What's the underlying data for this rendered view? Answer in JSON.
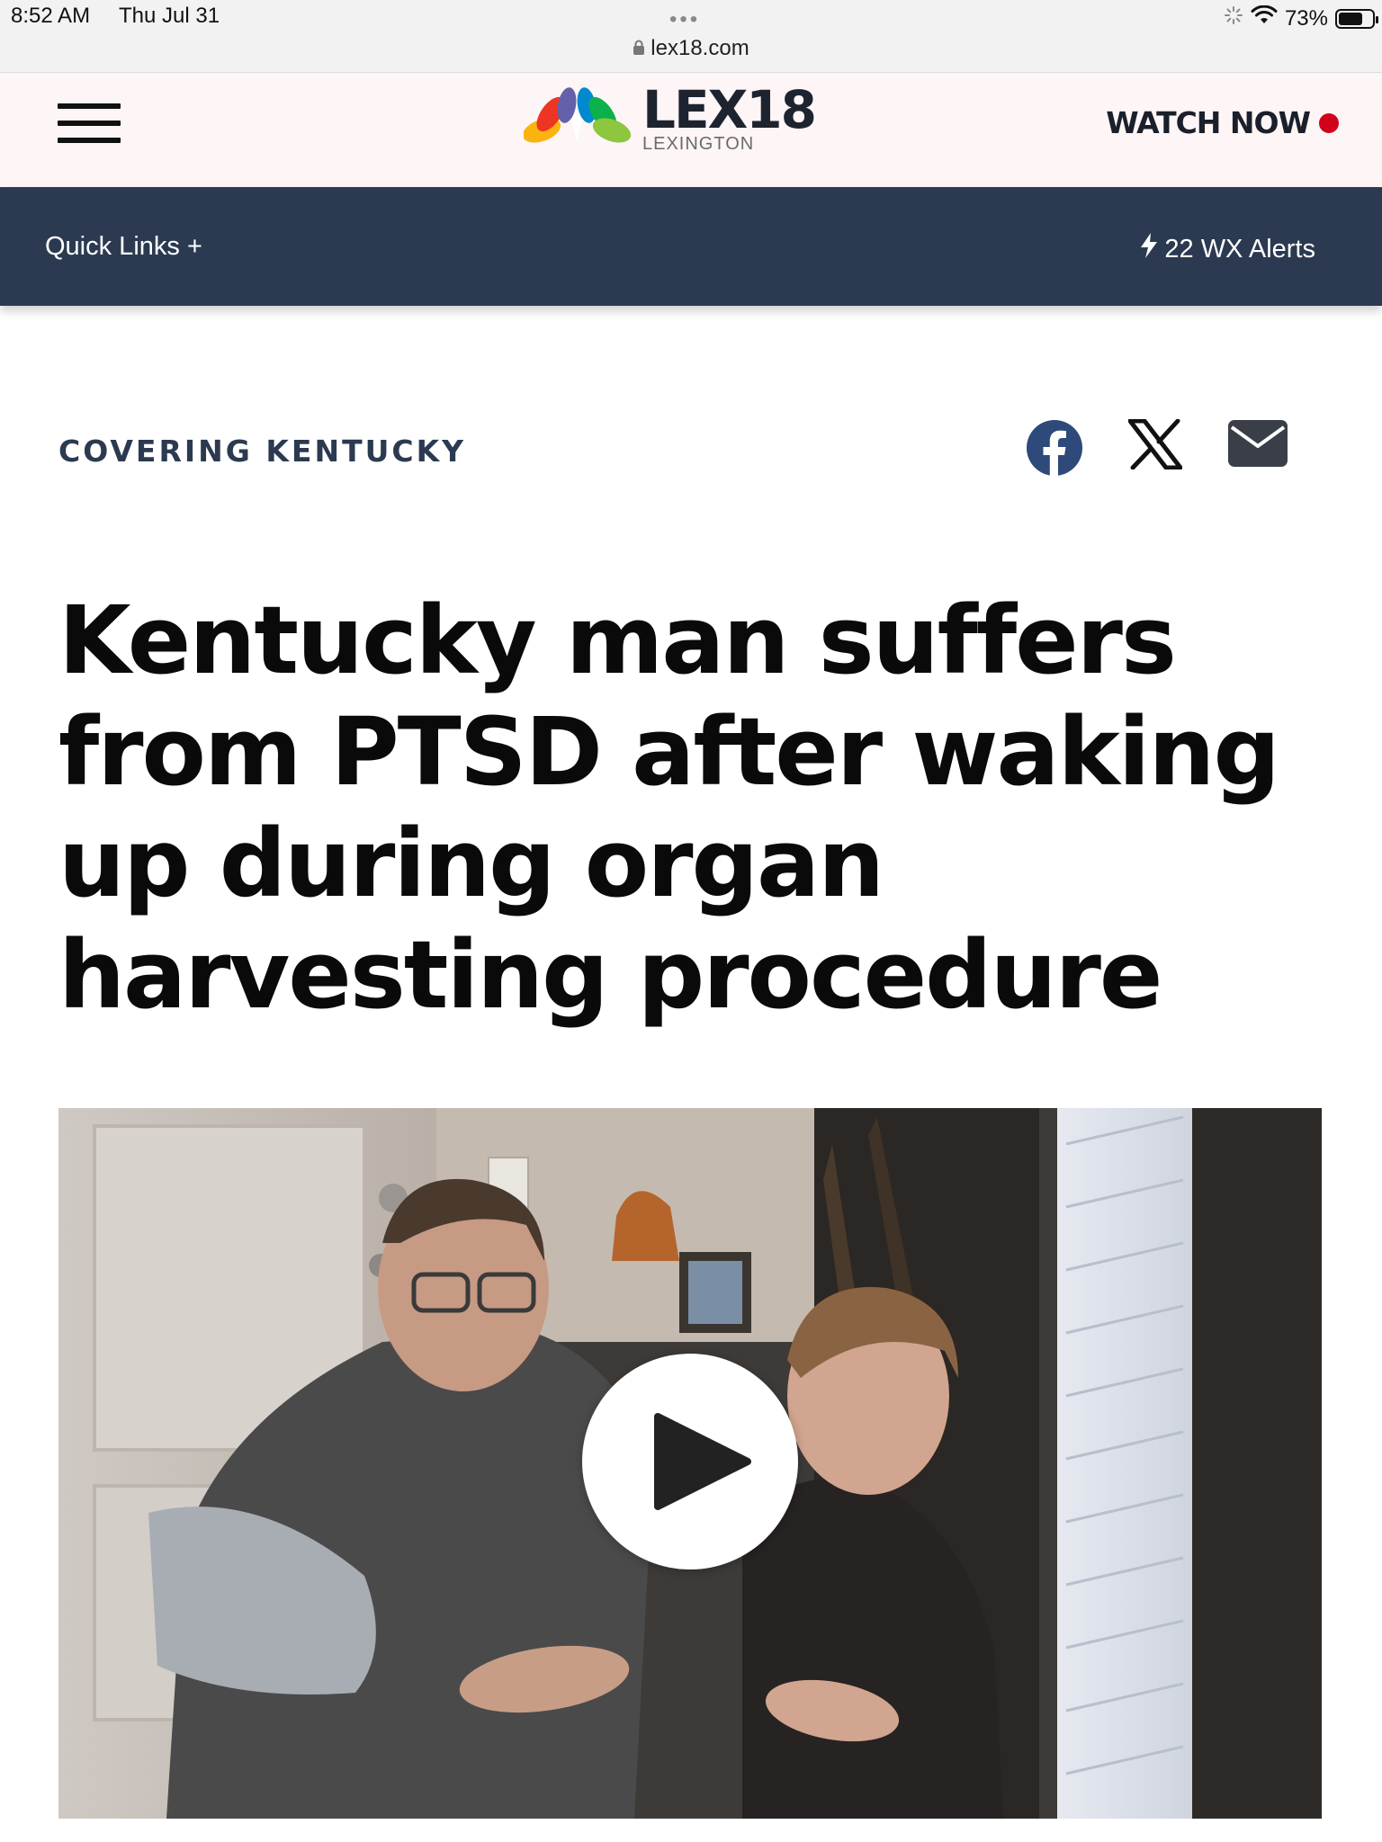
{
  "status_bar": {
    "time": "8:52 AM",
    "date": "Thu Jul 31",
    "url": "lex18.com",
    "battery": "73%",
    "battery_level": 0.73
  },
  "header": {
    "logo_main": "LEX18",
    "logo_sub": "LEXINGTON",
    "watch_now": "WATCH NOW",
    "live_color": "#d0021b"
  },
  "nav": {
    "quick_links": "Quick Links +",
    "wx_alerts": "22 WX Alerts"
  },
  "article": {
    "section": "COVERING KENTUCKY",
    "headline": "Kentucky man suffers from PTSD after waking up during organ harvesting procedure",
    "share_icons": [
      "facebook-icon",
      "x-icon",
      "mail-icon"
    ]
  },
  "colors": {
    "nav_bg": "#2b3a50",
    "header_bg": "#fdf5f6",
    "facebook": "#2d4a7a"
  }
}
